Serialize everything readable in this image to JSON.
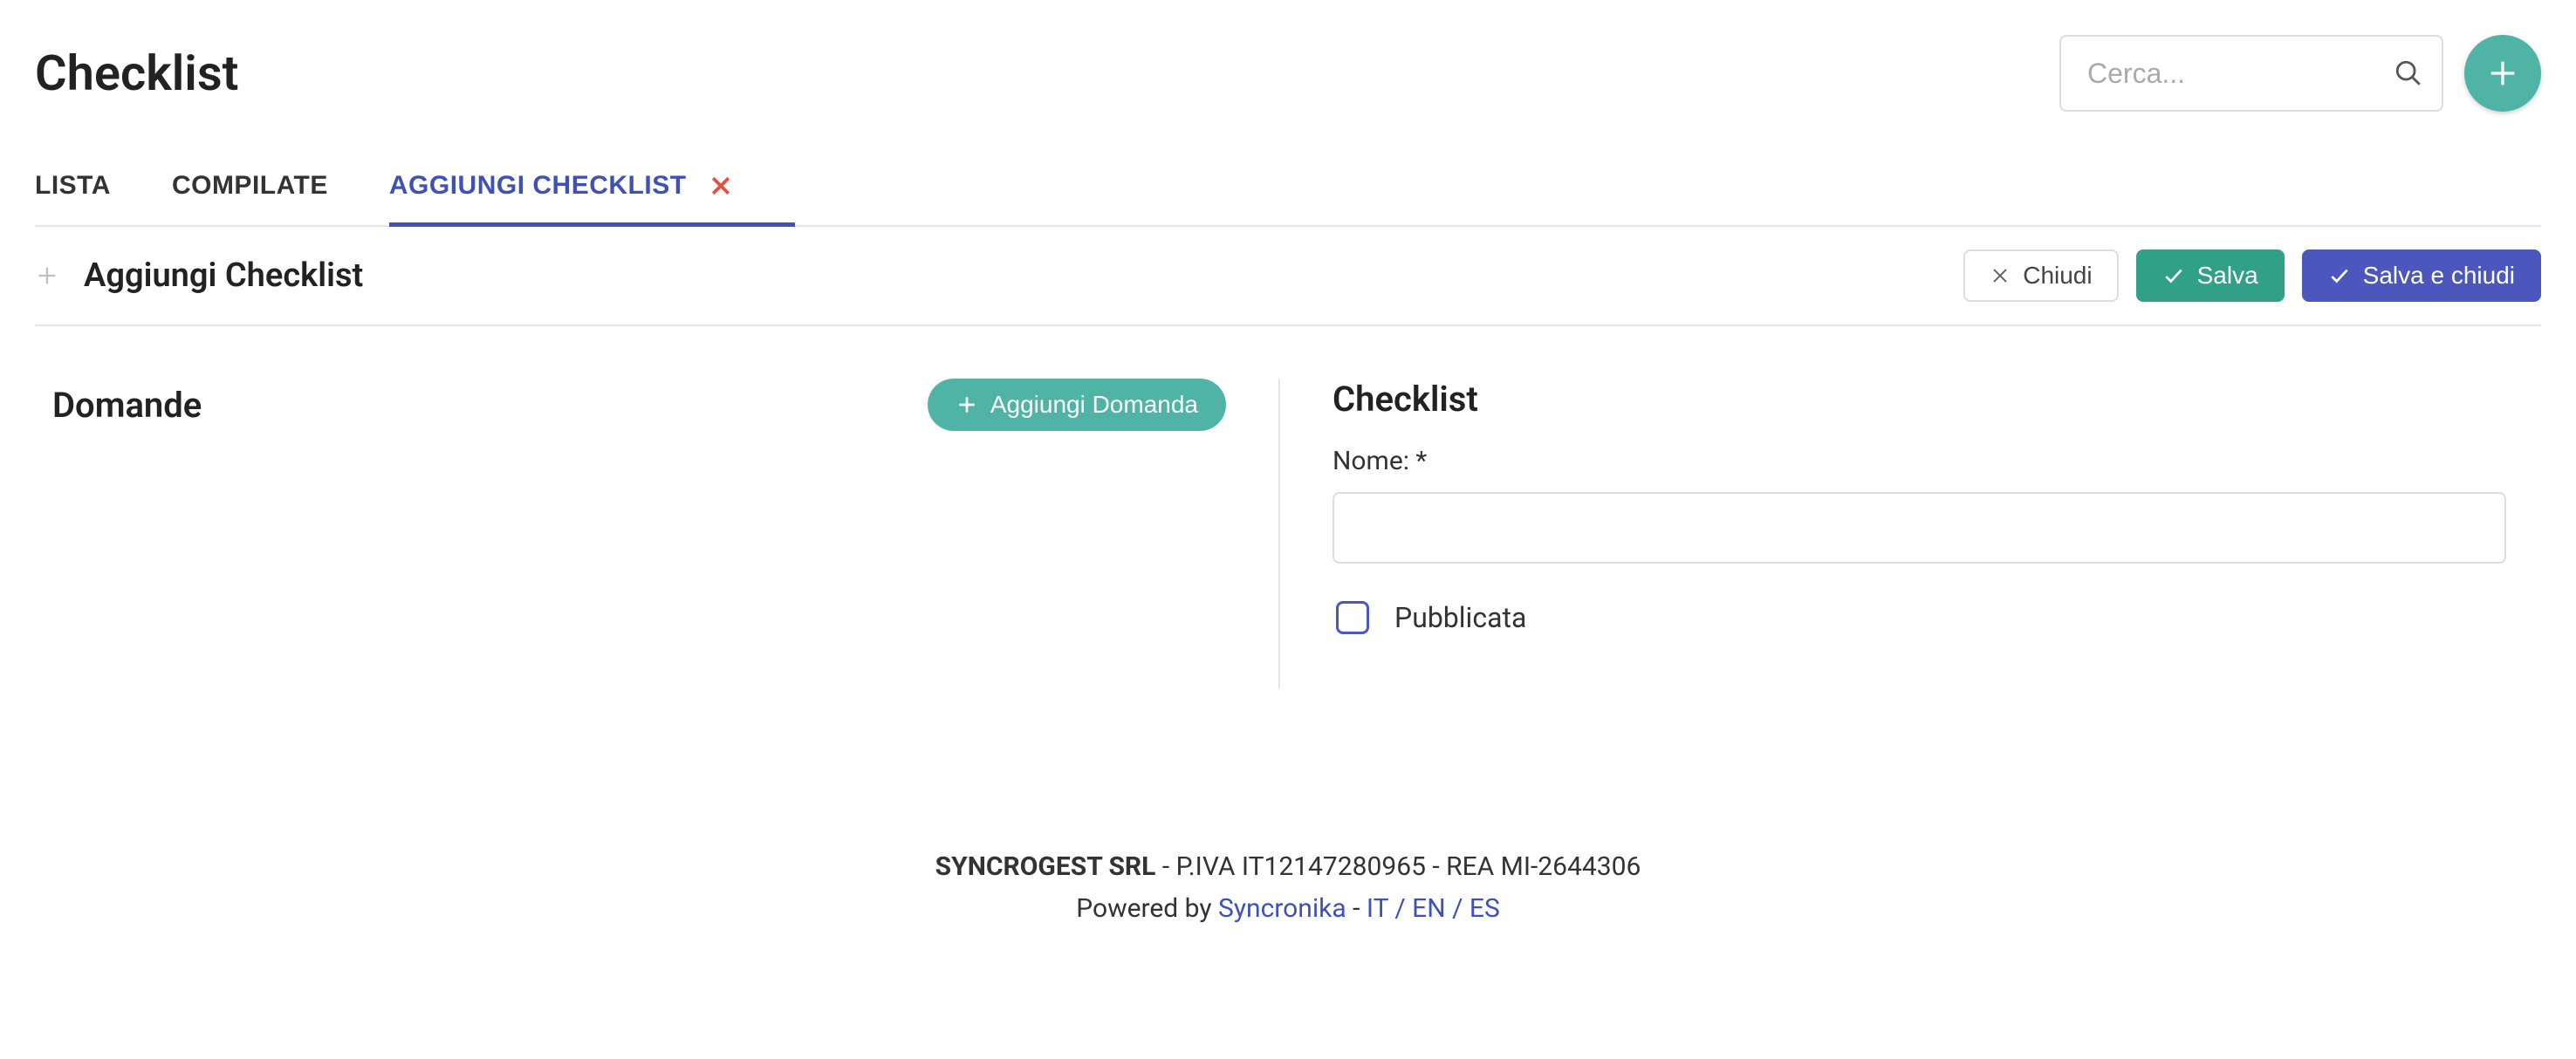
{
  "header": {
    "title": "Checklist",
    "search_placeholder": "Cerca..."
  },
  "tabs": {
    "list": "LISTA",
    "compiled": "COMPILATE",
    "add": "AGGIUNGI CHECKLIST"
  },
  "section": {
    "title": "Aggiungi Checklist",
    "close": "Chiudi",
    "save": "Salva",
    "save_close": "Salva e chiudi"
  },
  "left": {
    "title": "Domande",
    "add_question": "Aggiungi Domanda"
  },
  "right": {
    "title": "Checklist",
    "name_label": "Nome: *",
    "name_value": "",
    "published_label": "Pubblicata"
  },
  "footer": {
    "company": "SYNCROGEST SRL",
    "company_details": " - P.IVA IT12147280965 - REA MI-2644306",
    "powered_by": "Powered by ",
    "powered_link": "Syncronika",
    "lang_sep": " - ",
    "lang_it": "IT",
    "lang_en": "EN",
    "lang_es": "ES",
    "lang_div": " / "
  }
}
